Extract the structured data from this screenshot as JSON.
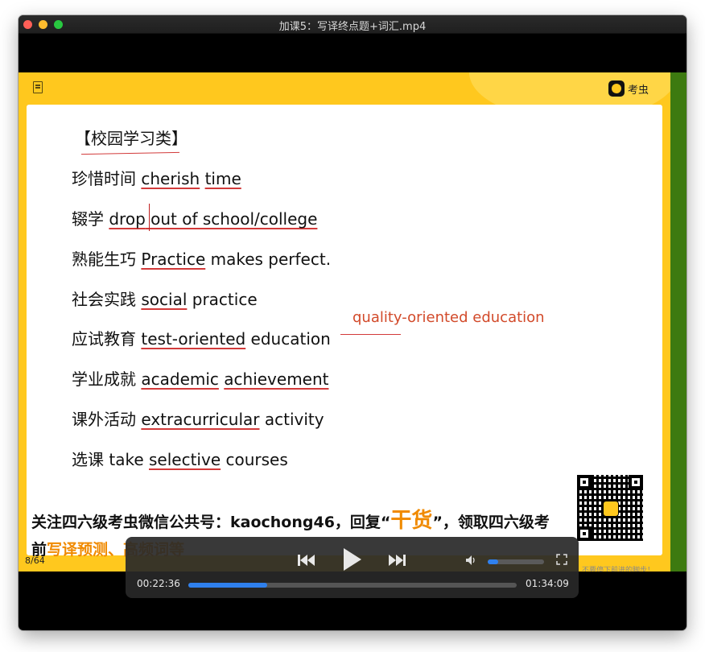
{
  "window": {
    "title": "加课5：写译终点题+词汇.mp4"
  },
  "brand": {
    "name": "考虫"
  },
  "slide": {
    "heading": "【校园学习类】",
    "rows": [
      {
        "zh": "珍惜时间 ",
        "parts": [
          "cherish",
          " ",
          "time"
        ]
      },
      {
        "zh": "辍学 ",
        "parts": [
          "drop",
          " out of school/college"
        ]
      },
      {
        "zh": "熟能生巧 ",
        "parts": [
          "Practice",
          " makes perfect."
        ]
      },
      {
        "zh": "社会实践 ",
        "parts": [
          "social",
          " practice"
        ]
      },
      {
        "zh": "应试教育 ",
        "parts": [
          "test-oriented",
          " education"
        ]
      },
      {
        "zh": "学业成就 ",
        "parts": [
          "academic",
          " ",
          "achievement"
        ]
      },
      {
        "zh": "课外活动 ",
        "parts": [
          "extracurricular",
          " activity"
        ]
      },
      {
        "zh": "选课 take ",
        "parts": [
          "selective",
          " courses"
        ]
      }
    ],
    "annotation": "quality-oriented education",
    "promo": {
      "part1": "关注四六级考虫微信公共号：kaochong46，回复“",
      "highlight": "干货",
      "part2": "”，领取四六级考前",
      "highlight2": "写译预测、高频词等"
    },
    "side_note": "不要停下前进的脚步！",
    "page": "8/64"
  },
  "player": {
    "current_time": "00:22:36",
    "total_time": "01:34:09",
    "progress": 0.24,
    "volume": 0.18,
    "icons": {
      "prev": "skip-back-icon",
      "play": "play-icon",
      "next": "skip-forward-icon",
      "volume": "volume-icon",
      "fullscreen": "fullscreen-icon"
    }
  }
}
